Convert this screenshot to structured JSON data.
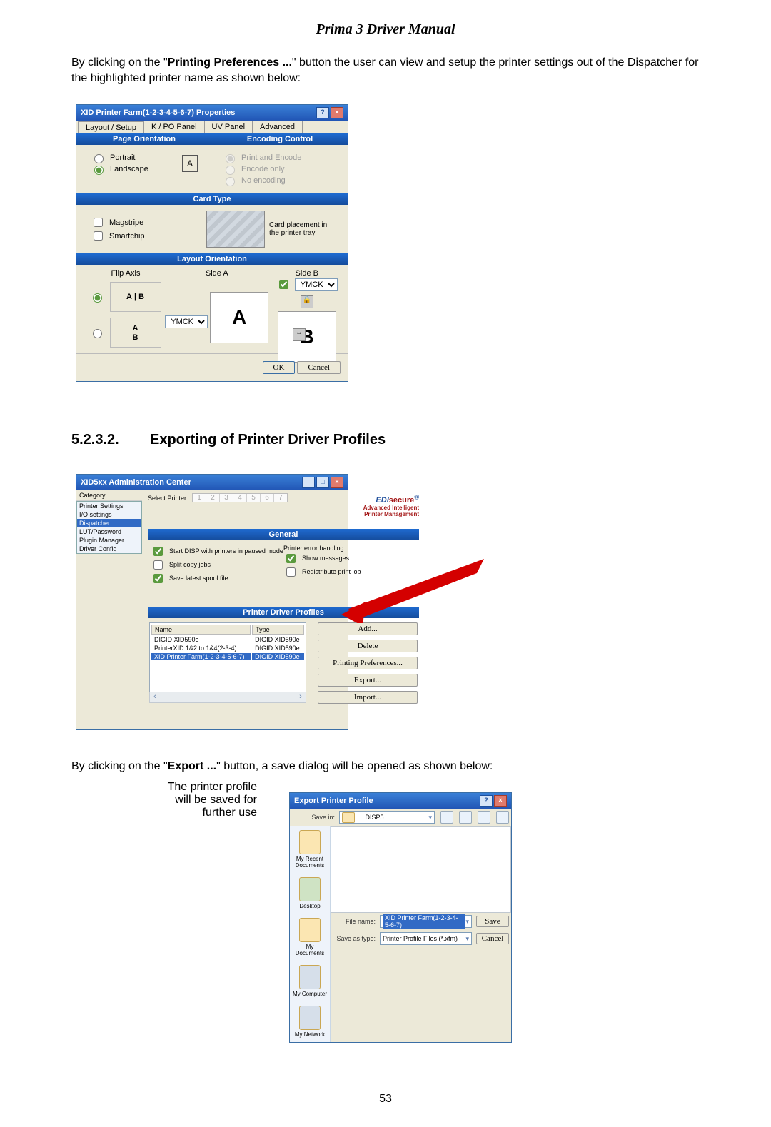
{
  "page_title": "Prima 3 Driver Manual",
  "intro1_pre": "By clicking on the \"",
  "intro1_bold": "Printing Preferences ...",
  "intro1_post": "\" button the user can view and setup the printer settings out of the Dispatcher for the highlighted printer name as shown below:",
  "prefs": {
    "title": "XID Printer Farm(1-2-3-4-5-6-7) Properties",
    "tabs": [
      "Layout / Setup",
      "K / PO Panel",
      "UV Panel",
      "Advanced"
    ],
    "orientation_header": "Page Orientation",
    "encoding_header": "Encoding Control",
    "portrait": "Portrait",
    "landscape": "Landscape",
    "orient_icon": "A",
    "enc1": "Print and Encode",
    "enc2": "Encode only",
    "enc3": "No encoding",
    "cardtype_header": "Card Type",
    "magstripe": "Magstripe",
    "smartchip": "Smartchip",
    "cardplacement": "Card placement in the printer tray",
    "layout_header": "Layout Orientation",
    "flipaxis": "Flip Axis",
    "sidea": "Side A",
    "sideb": "Side B",
    "sel_val": "YMCK",
    "big_a": "A",
    "big_b": "B",
    "ab1": "A",
    "ab1b": "B",
    "ab2": "A",
    "ab2b": "B",
    "ok": "OK",
    "cancel": "Cancel"
  },
  "section_num": "5.2.3.2.",
  "section_title": "Exporting of Printer Driver Profiles",
  "admin": {
    "title": "XID5xx Administration Center",
    "cat_label": "Category",
    "cats": [
      "Printer Settings",
      "I/O settings",
      "Dispatcher",
      "LUT/Password",
      "Plugin Manager",
      "Driver Config"
    ],
    "select_printer": "Select Printer",
    "picks": [
      "1",
      "2",
      "3",
      "4",
      "5",
      "6",
      "7"
    ],
    "logo_left": "EDI",
    "logo_right": "secure",
    "logo_reg": "®",
    "tagline1": "Advanced Intelligent",
    "tagline2": "Printer Management",
    "general_header": "General",
    "opt1": "Start DISP with printers in paused mode",
    "opt2": "Split copy jobs",
    "opt3": "Save latest spool file",
    "err_head": "Printer error handling",
    "err1": "Show messages",
    "err2": "Redistribute print job",
    "profiles_header": "Printer Driver Profiles",
    "col_name": "Name",
    "col_type": "Type",
    "rows": [
      {
        "n": "DIGID XID590e",
        "t": "DIGID XID590e"
      },
      {
        "n": "PrinterXID 1&2 to 1&4(2-3-4)",
        "t": "DIGID XID590e"
      },
      {
        "n": "XID Printer Farm(1-2-3-4-5-6-7)",
        "t": "DIGID XID590e"
      }
    ],
    "btns": [
      "Add...",
      "Delete",
      "Printing Preferences...",
      "Export...",
      "Import..."
    ]
  },
  "export_para_pre": "By clicking on the \"",
  "export_para_bold": "Export ...",
  "export_para_post": "\" button, a save dialog will be opened as shown below:",
  "save": {
    "title": "Export Printer Profile",
    "save_in": "Save in:",
    "folder": "DISP5",
    "places": [
      "My Recent Documents",
      "Desktop",
      "My Documents",
      "My Computer",
      "My Network"
    ],
    "file_name_lbl": "File name:",
    "file_name": "XID Printer Farm(1-2-3-4-5-6-7)",
    "type_lbl": "Save as type:",
    "type": "Printer Profile Files (*.xfm)",
    "save_btn": "Save",
    "cancel_btn": "Cancel"
  },
  "caption_l1": "The printer profile",
  "caption_l2": "will be saved for",
  "caption_l3": "further use",
  "page_number": "53"
}
